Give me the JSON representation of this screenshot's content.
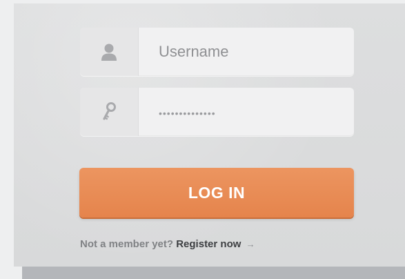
{
  "login_form": {
    "username_field": {
      "placeholder": "Username",
      "icon": "user-icon"
    },
    "password_field": {
      "value": "••••••••••••••",
      "icon": "key-icon"
    },
    "login_button_label": "LOG IN",
    "register_prompt": "Not a member yet?",
    "register_link": "Register now",
    "register_arrow": "→"
  },
  "colors": {
    "accent": "#e98a52",
    "panel_background": "#dbdcdd",
    "field_background": "#f1f1f2",
    "link_text": "#3d3f42"
  }
}
